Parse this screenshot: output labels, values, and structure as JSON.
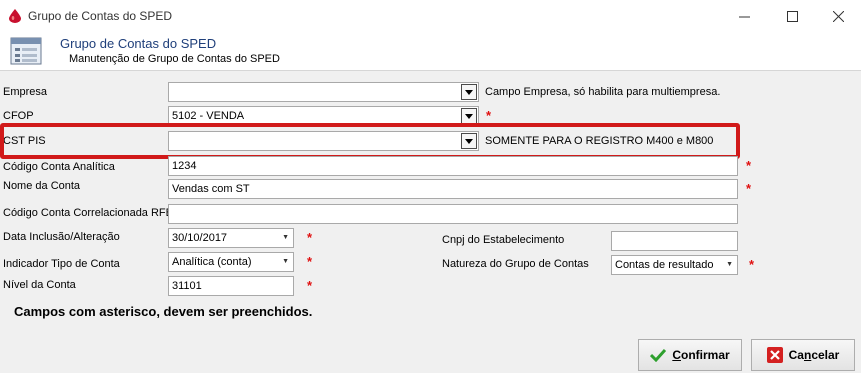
{
  "window": {
    "title": "Grupo de Contas do SPED"
  },
  "header": {
    "title": "Grupo de Contas do SPED",
    "subtitle": "Manutenção de Grupo de Contas do SPED"
  },
  "form": {
    "empresa": {
      "label": "Empresa",
      "value": "",
      "hint": "Campo Empresa, só habilita para multiempresa."
    },
    "cfop": {
      "label": "CFOP",
      "value": "5102 - VENDA"
    },
    "cst_pis": {
      "label": "CST PIS",
      "value": "",
      "hint": "SOMENTE PARA O REGISTRO M400 e M800"
    },
    "codigo_conta": {
      "label": "Código Conta Analítica",
      "value": "1234"
    },
    "nome_conta": {
      "label": "Nome da Conta",
      "value": "Vendas com ST"
    },
    "codigo_rfb": {
      "label": "Código Conta Correlacionada RFB",
      "value": ""
    },
    "data_inclusao": {
      "label": "Data Inclusão/Alteração",
      "value": "30/10/2017"
    },
    "indicador_tipo": {
      "label": "Indicador Tipo de Conta",
      "value": "Analítica (conta)"
    },
    "nivel_conta": {
      "label": "Nível da Conta",
      "value": "31101"
    },
    "cnpj": {
      "label": "Cnpj do Estabelecimento",
      "value": ""
    },
    "natureza": {
      "label": "Natureza do Grupo de Contas",
      "value": "Contas de resultado"
    },
    "required_mark": "*"
  },
  "notice": "Campos com asterisco, devem ser preenchidos.",
  "buttons": {
    "confirm_prefix": "C",
    "confirm_rest": "onfirmar",
    "cancel_prefix": "Ca",
    "cancel_u": "n",
    "cancel_rest": "celar"
  },
  "colors": {
    "highlight": "#d11a1a",
    "required": "#e01010",
    "header_title": "#1f3f7a"
  }
}
